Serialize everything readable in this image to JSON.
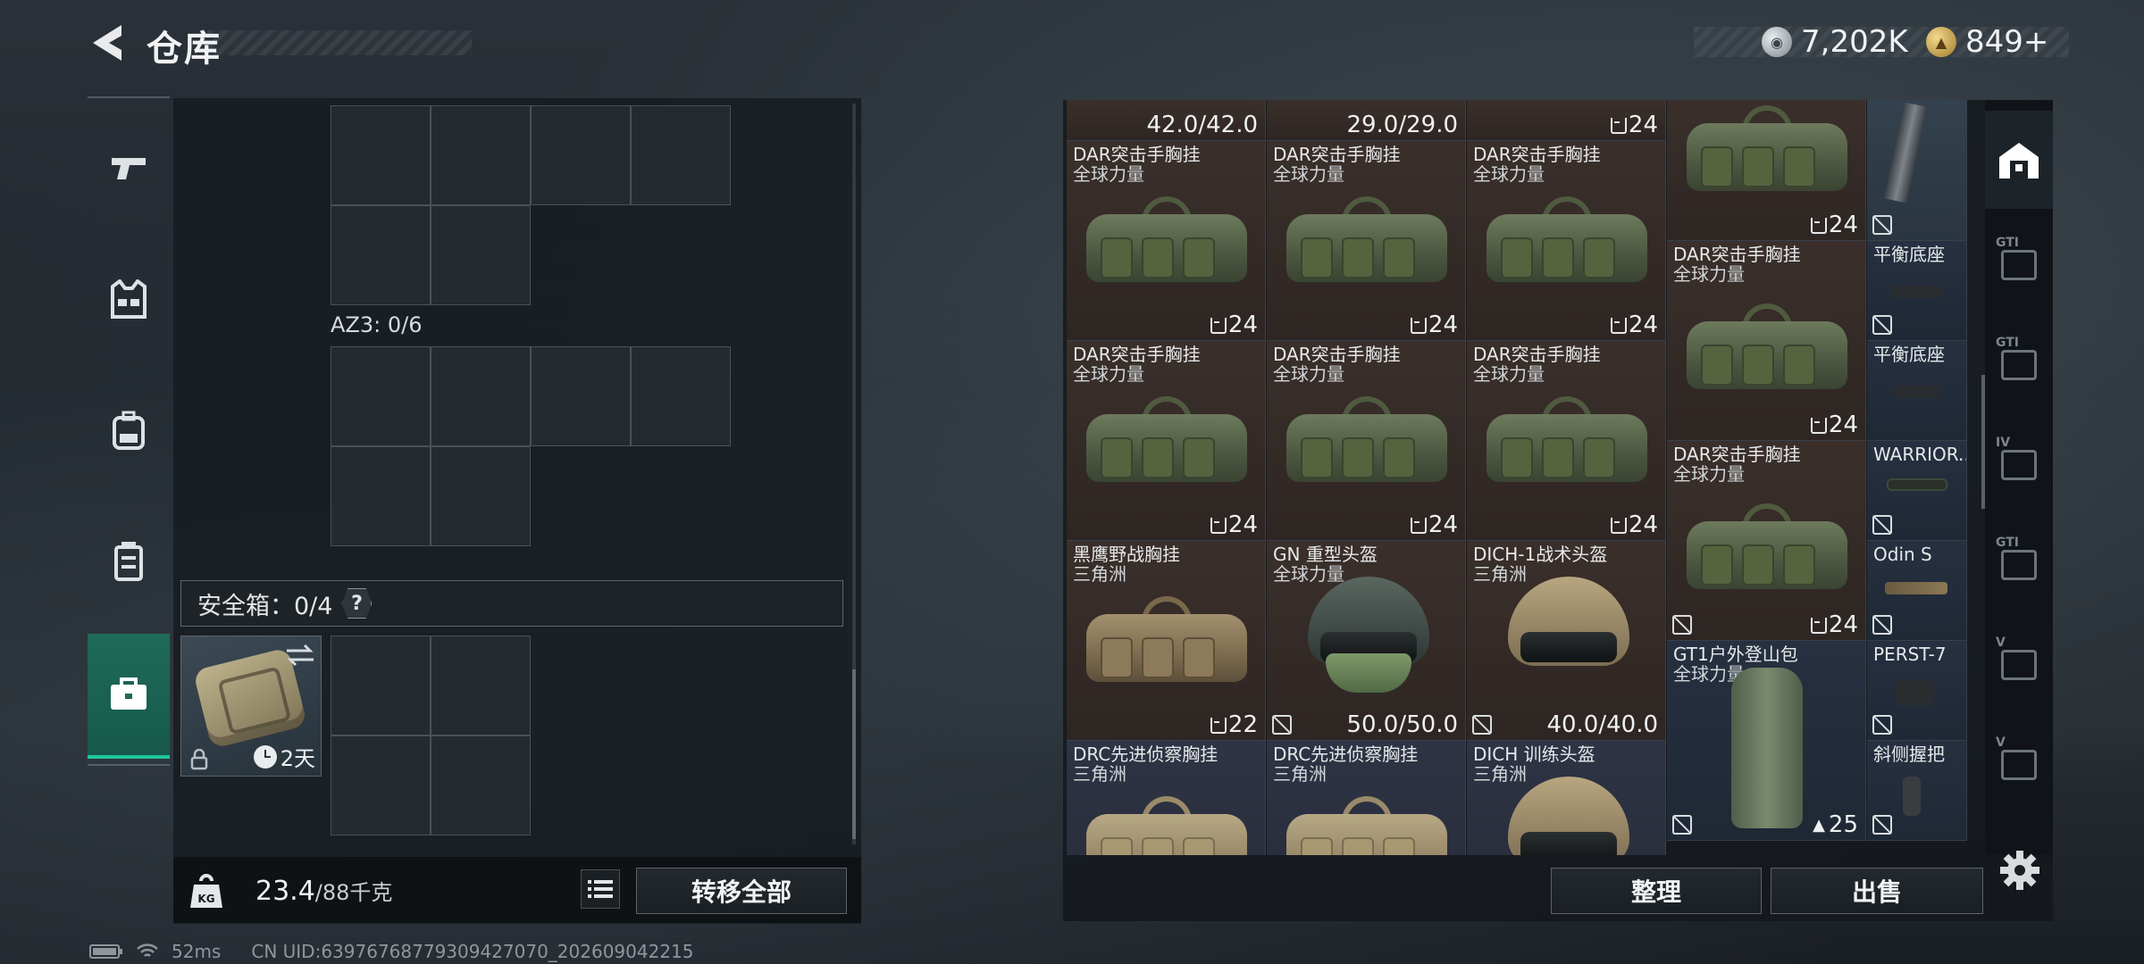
{
  "header": {
    "title": "仓库",
    "currency_silver": "7,202K",
    "currency_gold": "849+"
  },
  "left_nav": {
    "items": [
      {
        "icon": "pistol-icon"
      },
      {
        "icon": "vest-icon"
      },
      {
        "icon": "backpack-icon"
      },
      {
        "icon": "armor-icon"
      },
      {
        "icon": "safe-case-icon",
        "active": true
      }
    ]
  },
  "container": {
    "az3_label": "AZ3: 0/6",
    "safe_box_label": "安全箱：0/4",
    "safe_help": "?",
    "safe_case_days": "2天"
  },
  "bottom_left": {
    "weight_current": "23.4",
    "weight_max": "/88千克",
    "transfer_all": "转移全部"
  },
  "status": {
    "ping": "52ms",
    "uid": "CN UID:63976768779309427070_202609042215"
  },
  "inventory": {
    "top_row": [
      {
        "value": "42.0/42.0"
      },
      {
        "value": "29.0/29.0"
      },
      {
        "value": "24"
      }
    ],
    "items": [
      {
        "name": "DAR突击手胸挂",
        "sub": "全球力量",
        "count": "24",
        "bg": "brown",
        "art": "bag"
      },
      {
        "name": "DAR突击手胸挂",
        "sub": "全球力量",
        "count": "24",
        "bg": "brown",
        "art": "bag"
      },
      {
        "name": "DAR突击手胸挂",
        "sub": "全球力量",
        "count": "24",
        "bg": "brown",
        "art": "bag"
      },
      {
        "name": "DAR突击手胸挂",
        "sub": "全球力量",
        "count": "24",
        "bg": "brown",
        "art": "bag"
      },
      {
        "name": "DAR突击手胸挂",
        "sub": "全球力量",
        "count": "24",
        "bg": "brown",
        "art": "bag"
      },
      {
        "name": "DAR突击手胸挂",
        "sub": "全球力量",
        "count": "24",
        "bg": "brown",
        "art": "bag"
      },
      {
        "name": "黑鹰野战胸挂",
        "sub": "三角洲",
        "count": "22",
        "bg": "brown",
        "art": "bag-tan"
      },
      {
        "name": "GN 重型头盔",
        "sub": "全球力量",
        "count": "50.0/50.0",
        "bg": "brown",
        "art": "helmet-green"
      },
      {
        "name": "DICH-1战术头盔",
        "sub": "三角洲",
        "count": "40.0/40.0",
        "bg": "brown",
        "art": "helmet-tan"
      },
      {
        "name": "DRC先进侦察胸挂",
        "sub": "三角洲",
        "count": "",
        "bg": "blue",
        "art": "bag-khaki"
      },
      {
        "name": "DRC先进侦察胸挂",
        "sub": "三角洲",
        "count": "",
        "bg": "blue",
        "art": "bag-khaki"
      },
      {
        "name": "DICH 训练头盔",
        "sub": "三角洲",
        "count": "",
        "bg": "blue",
        "art": "helmet-tan"
      }
    ],
    "col4": [
      {
        "name": "",
        "sub": "",
        "count": "24"
      },
      {
        "name": "DAR突击手胸挂",
        "sub": "全球力量",
        "count": "24"
      },
      {
        "name": "DAR突击手胸挂",
        "sub": "全球力量",
        "count": "24"
      },
      {
        "name": "GT1户外登山包",
        "sub": "全球力量",
        "count": "25"
      }
    ],
    "col5": [
      {
        "name": ""
      },
      {
        "name": "平衡底座"
      },
      {
        "name": "平衡底座"
      },
      {
        "name": "WARRIOR..."
      },
      {
        "name": "Odin S"
      },
      {
        "name": "PERST-7"
      },
      {
        "name": "斜侧握把"
      }
    ]
  },
  "right_nav": {
    "labels": [
      "GTI",
      "GTI",
      "IV",
      "GTI",
      "V",
      "V"
    ]
  },
  "buttons": {
    "organize": "整理",
    "sell": "出售"
  },
  "colors": {
    "accent_green": "#1ec79a",
    "item_brown": "#3a2f2b",
    "item_blue": "#2e3444"
  }
}
